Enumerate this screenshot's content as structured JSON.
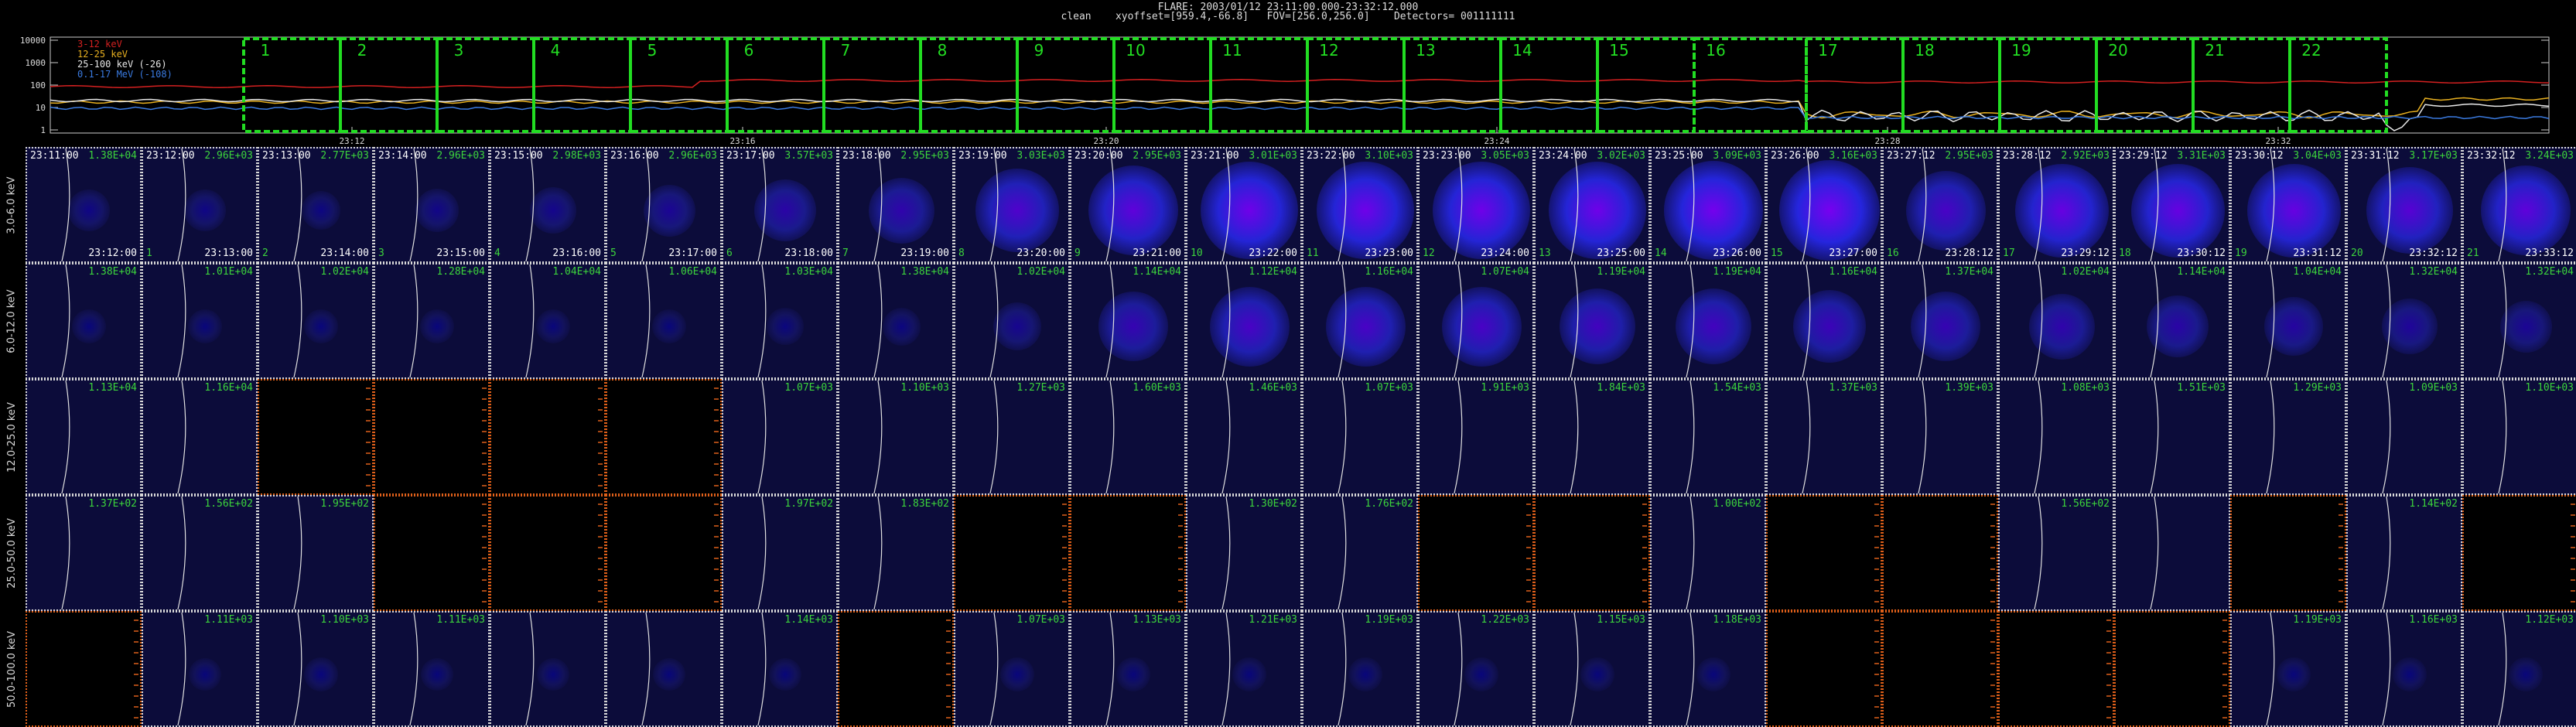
{
  "header": {
    "title": "FLARE: 2003/01/12 23:11:00.000-23:32:12.000",
    "subtitle": "clean    xyoffset=[959.4,-66.8]   FOV=[256.0,256.0]    Detectors= 001111111"
  },
  "lightcurve": {
    "y_ticks": [
      "10000",
      "1000",
      "100",
      "10",
      "1"
    ],
    "x_ticks": [
      "23:12",
      "23:16",
      "23:20",
      "23:24",
      "23:28",
      "23:32"
    ],
    "legend": [
      {
        "label": "3-12 keV",
        "color": "#d42020"
      },
      {
        "label": "12-25 keV",
        "color": "#e8b020"
      },
      {
        "label": "25-100 keV (-26)",
        "color": "#e8e8e8"
      },
      {
        "label": "0.1-17 MeV (-108)",
        "color": "#3a7ae0"
      }
    ],
    "boxes": [
      "1",
      "2",
      "3",
      "4",
      "5",
      "6",
      "7",
      "8",
      "9",
      "10",
      "11",
      "12",
      "13",
      "14",
      "15",
      "16",
      "17",
      "18",
      "19",
      "20",
      "21",
      "22"
    ]
  },
  "rows": [
    {
      "label": "3.0-6.0 keV"
    },
    {
      "label": "6.0-12.0 keV"
    },
    {
      "label": "12.0-25.0 keV"
    },
    {
      "label": "25.0-50.0 keV"
    },
    {
      "label": "50.0-100.0 keV"
    }
  ],
  "start_times": [
    "23:11:00",
    "23:12:00",
    "23:13:00",
    "23:14:00",
    "23:15:00",
    "23:16:00",
    "23:17:00",
    "23:18:00",
    "23:19:00",
    "23:20:00",
    "23:21:00",
    "23:22:00",
    "23:23:00",
    "23:24:00",
    "23:25:00",
    "23:26:00",
    "23:27:12",
    "23:28:12",
    "23:29:12",
    "23:30:12",
    "23:31:12",
    "23:32:12"
  ],
  "end_times": [
    "23:12:00",
    "23:13:00",
    "23:14:00",
    "23:15:00",
    "23:16:00",
    "23:17:00",
    "23:18:00",
    "23:19:00",
    "23:20:00",
    "23:21:00",
    "23:22:00",
    "23:23:00",
    "23:24:00",
    "23:25:00",
    "23:26:00",
    "23:27:00",
    "23:28:12",
    "23:29:12",
    "23:30:12",
    "23:31:12",
    "23:32:12",
    "23:33:12"
  ],
  "values": [
    [
      "1.38E+04",
      "2.96E+03",
      "2.77E+03",
      "2.96E+03",
      "2.98E+03",
      "2.96E+03",
      "3.57E+03",
      "2.95E+03",
      "3.03E+03",
      "2.95E+03",
      "3.01E+03",
      "3.10E+03",
      "3.05E+03",
      "3.02E+03",
      "3.09E+03",
      "3.16E+03",
      "2.95E+03",
      "2.92E+03",
      "3.31E+03",
      "3.04E+03",
      "3.17E+03",
      "3.24E+03"
    ],
    [
      "1.38E+04",
      "1.01E+04",
      "1.02E+04",
      "1.28E+04",
      "1.04E+04",
      "1.06E+04",
      "1.03E+04",
      "1.38E+04",
      "1.02E+04",
      "1.14E+04",
      "1.12E+04",
      "1.16E+04",
      "1.07E+04",
      "1.19E+04",
      "1.19E+04",
      "1.16E+04",
      "1.37E+04",
      "1.02E+04",
      "1.14E+04",
      "1.04E+04",
      "1.32E+04",
      "1.32E+04"
    ],
    [
      "1.13E+04",
      "1.16E+04",
      "",
      "",
      "",
      "",
      "1.07E+03",
      "1.10E+03",
      "1.27E+03",
      "1.60E+03",
      "1.46E+03",
      "1.07E+03",
      "1.91E+03",
      "1.84E+03",
      "1.54E+03",
      "1.37E+03",
      "1.39E+03",
      "1.08E+03",
      "1.51E+03",
      "1.29E+03",
      "1.09E+03",
      "1.10E+03"
    ],
    [
      "1.37E+02",
      "1.56E+02",
      "1.95E+02",
      "",
      "",
      "",
      "1.97E+02",
      "1.83E+02",
      "",
      "",
      "1.30E+02",
      "1.76E+02",
      "",
      "",
      "1.00E+02",
      "",
      "",
      "1.56E+02",
      "",
      "",
      "1.14E+02",
      ""
    ],
    [
      "",
      "1.11E+03",
      "1.10E+03",
      "1.11E+03",
      "",
      "",
      "1.14E+03",
      "",
      "1.07E+03",
      "1.13E+03",
      "1.21E+03",
      "1.19E+03",
      "1.22E+03",
      "1.15E+03",
      "1.18E+03",
      "",
      "",
      "",
      "",
      "1.19E+03",
      "1.16E+03",
      "1.12E+03"
    ]
  ],
  "black_cells": [
    [],
    [],
    [
      2,
      3,
      4,
      5
    ],
    [
      3,
      4,
      5,
      8,
      9,
      12,
      13,
      15,
      16,
      19,
      21
    ],
    [
      0,
      7,
      15,
      16,
      17,
      18
    ]
  ],
  "brightness": [
    [
      0.15,
      0.15,
      0.12,
      0.18,
      0.22,
      0.3,
      0.45,
      0.5,
      0.75,
      0.85,
      0.95,
      0.95,
      0.95,
      0.95,
      0.98,
      1.0,
      0.7,
      0.9,
      0.9,
      0.9,
      0.8,
      0.85
    ],
    [
      0.05,
      0.05,
      0.05,
      0.05,
      0.05,
      0.05,
      0.08,
      0.1,
      0.25,
      0.55,
      0.7,
      0.7,
      0.7,
      0.65,
      0.65,
      0.6,
      0.55,
      0.5,
      0.45,
      0.4,
      0.35,
      0.3
    ],
    [
      0,
      0,
      0,
      0,
      0,
      0,
      0,
      0,
      0,
      0,
      0,
      0,
      0,
      0,
      0,
      0,
      0,
      0,
      0,
      0,
      0,
      0
    ],
    [
      0,
      0,
      0,
      0,
      0,
      0,
      0,
      0,
      0,
      0,
      0,
      0,
      0,
      0,
      0,
      0,
      0,
      0,
      0,
      0,
      0,
      0
    ],
    [
      0.03,
      0.03,
      0.05,
      0.03,
      0.03,
      0.03,
      0.03,
      0.03,
      0.05,
      0.04,
      0.04,
      0.04,
      0.04,
      0.04,
      0.04,
      0.04,
      0.04,
      0.04,
      0.04,
      0.04,
      0.04,
      0.04
    ]
  ],
  "colors": {
    "cell_bg": "#0c0c3a",
    "box_green": "#22dd22",
    "value_green": "#3cd43c",
    "black_border": "#e0601a",
    "red": "#d42020"
  }
}
